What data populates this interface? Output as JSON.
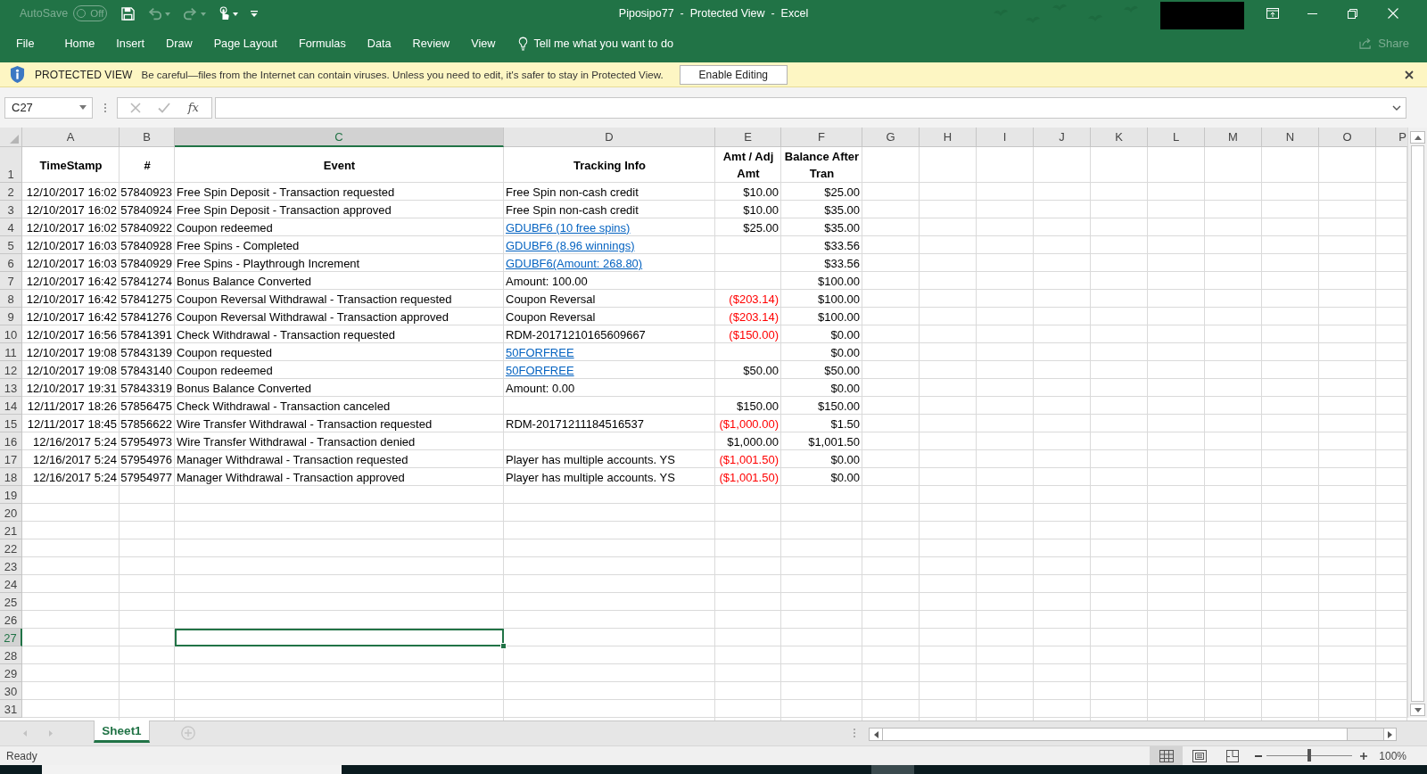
{
  "window": {
    "title": "Piposipo77  -  Protected View  -  Excel"
  },
  "quick_access": {
    "autosave": {
      "label": "AutoSave",
      "toggle_label": "Off",
      "on": false,
      "disabled": true
    },
    "buttons": [
      {
        "kind": "save",
        "disabled": false
      },
      {
        "kind": "undo",
        "disabled": true
      },
      {
        "kind": "redo",
        "disabled": true
      },
      {
        "kind": "touch",
        "disabled": false
      },
      {
        "kind": "customize",
        "disabled": false
      }
    ]
  },
  "ribbon": {
    "tabs": [
      {
        "label": "File"
      },
      {
        "label": "Home"
      },
      {
        "label": "Insert"
      },
      {
        "label": "Draw"
      },
      {
        "label": "Page Layout"
      },
      {
        "label": "Formulas"
      },
      {
        "label": "Data"
      },
      {
        "label": "Review"
      },
      {
        "label": "View"
      }
    ],
    "tell_me": {
      "placeholder": "Tell me what you want to do"
    },
    "share": {
      "label": "Share",
      "disabled": true
    }
  },
  "protected_view": {
    "title": "PROTECTED VIEW",
    "message": "Be careful—files from the Internet can contain viruses. Unless you need to edit, it's safer to stay in Protected View.",
    "button": "Enable Editing"
  },
  "formula_bar": {
    "name_box": "C27",
    "insert_function": "fx"
  },
  "sheet": {
    "columns": [
      {
        "label": "A",
        "selected": false
      },
      {
        "label": "B",
        "selected": false
      },
      {
        "label": "C",
        "selected": true
      },
      {
        "label": "D",
        "selected": false
      },
      {
        "label": "E",
        "selected": false
      },
      {
        "label": "F",
        "selected": false
      },
      {
        "label": "G",
        "selected": false
      },
      {
        "label": "H",
        "selected": false
      },
      {
        "label": "I",
        "selected": false
      },
      {
        "label": "J",
        "selected": false
      },
      {
        "label": "K",
        "selected": false
      },
      {
        "label": "L",
        "selected": false
      },
      {
        "label": "M",
        "selected": false
      },
      {
        "label": "N",
        "selected": false
      },
      {
        "label": "O",
        "selected": false
      },
      {
        "label": "P",
        "selected": false
      }
    ],
    "rows": [
      {
        "row_number": "1",
        "selected": false,
        "kind": "header",
        "labels": [
          "TimeStamp",
          "#",
          "Event",
          "Tracking Info",
          "Amt / Adj Amt",
          "Balance After Tran"
        ]
      },
      {
        "row_number": "2",
        "selected": false,
        "kind": "data",
        "timestamp": "12/10/2017 16:02",
        "transaction_no": "57840923",
        "event": "Free Spin Deposit - Transaction requested",
        "tracking_info": {
          "text": "Free Spin non-cash credit",
          "link": false
        },
        "amount": {
          "text": "$10.00",
          "negative": false
        },
        "balance": "$25.00"
      },
      {
        "row_number": "3",
        "selected": false,
        "kind": "data",
        "timestamp": "12/10/2017 16:02",
        "transaction_no": "57840924",
        "event": "Free Spin Deposit - Transaction approved",
        "tracking_info": {
          "text": "Free Spin non-cash credit",
          "link": false
        },
        "amount": {
          "text": "$10.00",
          "negative": false
        },
        "balance": "$35.00"
      },
      {
        "row_number": "4",
        "selected": false,
        "kind": "data",
        "timestamp": "12/10/2017 16:02",
        "transaction_no": "57840922",
        "event": "Coupon redeemed",
        "tracking_info": {
          "text": "GDUBF6 (10 free spins)",
          "link": true
        },
        "amount": {
          "text": "$25.00",
          "negative": false
        },
        "balance": "$35.00"
      },
      {
        "row_number": "5",
        "selected": false,
        "kind": "data",
        "timestamp": "12/10/2017 16:03",
        "transaction_no": "57840928",
        "event": "Free Spins - Completed",
        "tracking_info": {
          "text": "GDUBF6 (8.96 winnings)",
          "link": true
        },
        "balance": "$33.56"
      },
      {
        "row_number": "6",
        "selected": false,
        "kind": "data",
        "timestamp": "12/10/2017 16:03",
        "transaction_no": "57840929",
        "event": "Free Spins - Playthrough Increment",
        "tracking_info": {
          "text": "GDUBF6(Amount: 268.80)",
          "link": true
        },
        "balance": "$33.56"
      },
      {
        "row_number": "7",
        "selected": false,
        "kind": "data",
        "timestamp": "12/10/2017 16:42",
        "transaction_no": "57841274",
        "event": "Bonus Balance Converted",
        "tracking_info": {
          "text": "Amount: 100.00",
          "link": false
        },
        "balance": "$100.00"
      },
      {
        "row_number": "8",
        "selected": false,
        "kind": "data",
        "timestamp": "12/10/2017 16:42",
        "transaction_no": "57841275",
        "event": "Coupon Reversal Withdrawal - Transaction requested",
        "tracking_info": {
          "text": "Coupon Reversal",
          "link": false
        },
        "amount": {
          "text": "($203.14)",
          "negative": true
        },
        "balance": "$100.00"
      },
      {
        "row_number": "9",
        "selected": false,
        "kind": "data",
        "timestamp": "12/10/2017 16:42",
        "transaction_no": "57841276",
        "event": "Coupon Reversal Withdrawal - Transaction approved",
        "tracking_info": {
          "text": "Coupon Reversal",
          "link": false
        },
        "amount": {
          "text": "($203.14)",
          "negative": true
        },
        "balance": "$100.00"
      },
      {
        "row_number": "10",
        "selected": false,
        "kind": "data",
        "timestamp": "12/10/2017 16:56",
        "transaction_no": "57841391",
        "event": "Check Withdrawal - Transaction requested",
        "tracking_info": {
          "text": "RDM-20171210165609667",
          "link": false
        },
        "amount": {
          "text": "($150.00)",
          "negative": true
        },
        "balance": "$0.00"
      },
      {
        "row_number": "11",
        "selected": false,
        "kind": "data",
        "timestamp": "12/10/2017 19:08",
        "transaction_no": "57843139",
        "event": "Coupon requested",
        "tracking_info": {
          "text": "50FORFREE",
          "link": true
        },
        "balance": "$0.00"
      },
      {
        "row_number": "12",
        "selected": false,
        "kind": "data",
        "timestamp": "12/10/2017 19:08",
        "transaction_no": "57843140",
        "event": "Coupon redeemed",
        "tracking_info": {
          "text": "50FORFREE",
          "link": true
        },
        "amount": {
          "text": "$50.00",
          "negative": false
        },
        "balance": "$50.00"
      },
      {
        "row_number": "13",
        "selected": false,
        "kind": "data",
        "timestamp": "12/10/2017 19:31",
        "transaction_no": "57843319",
        "event": "Bonus Balance Converted",
        "tracking_info": {
          "text": "Amount: 0.00",
          "link": false
        },
        "balance": "$0.00"
      },
      {
        "row_number": "14",
        "selected": false,
        "kind": "data",
        "timestamp": "12/11/2017 18:26",
        "transaction_no": "57856475",
        "event": "Check Withdrawal - Transaction canceled",
        "amount": {
          "text": "$150.00",
          "negative": false
        },
        "balance": "$150.00"
      },
      {
        "row_number": "15",
        "selected": false,
        "kind": "data",
        "timestamp": "12/11/2017 18:45",
        "transaction_no": "57856622",
        "event": "Wire Transfer Withdrawal - Transaction requested",
        "tracking_info": {
          "text": "RDM-20171211184516537",
          "link": false
        },
        "amount": {
          "text": "($1,000.00)",
          "negative": true
        },
        "balance": "$1.50"
      },
      {
        "row_number": "16",
        "selected": false,
        "kind": "data",
        "timestamp": "12/16/2017 5:24",
        "transaction_no": "57954973",
        "event": "Wire Transfer Withdrawal - Transaction denied",
        "amount": {
          "text": "$1,000.00",
          "negative": false
        },
        "balance": "$1,001.50"
      },
      {
        "row_number": "17",
        "selected": false,
        "kind": "data",
        "timestamp": "12/16/2017 5:24",
        "transaction_no": "57954976",
        "event": "Manager Withdrawal - Transaction requested",
        "tracking_info": {
          "text": "Player has multiple accounts. YS",
          "link": false
        },
        "amount": {
          "text": "($1,001.50)",
          "negative": true
        },
        "balance": "$0.00"
      },
      {
        "row_number": "18",
        "selected": false,
        "kind": "data",
        "timestamp": "12/16/2017 5:24",
        "transaction_no": "57954977",
        "event": "Manager Withdrawal - Transaction approved",
        "tracking_info": {
          "text": "Player has multiple accounts. YS",
          "link": false
        },
        "amount": {
          "text": "($1,001.50)",
          "negative": true
        },
        "balance": "$0.00"
      },
      {
        "row_number": "19",
        "selected": false,
        "kind": "data"
      },
      {
        "row_number": "20",
        "selected": false,
        "kind": "data"
      },
      {
        "row_number": "21",
        "selected": false,
        "kind": "data"
      },
      {
        "row_number": "22",
        "selected": false,
        "kind": "data"
      },
      {
        "row_number": "23",
        "selected": false,
        "kind": "data"
      },
      {
        "row_number": "24",
        "selected": false,
        "kind": "data"
      },
      {
        "row_number": "25",
        "selected": false,
        "kind": "data"
      },
      {
        "row_number": "26",
        "selected": false,
        "kind": "data"
      },
      {
        "row_number": "27",
        "selected": true,
        "kind": "data"
      },
      {
        "row_number": "28",
        "selected": false,
        "kind": "data"
      },
      {
        "row_number": "29",
        "selected": false,
        "kind": "data"
      },
      {
        "row_number": "30",
        "selected": false,
        "kind": "data"
      },
      {
        "row_number": "31",
        "selected": false,
        "kind": "data"
      }
    ]
  },
  "sheet_tabs": [
    {
      "label": "Sheet1",
      "selected": true
    }
  ],
  "status_bar": {
    "status": "Ready",
    "views": [
      {
        "kind": "normal",
        "selected": true
      },
      {
        "kind": "page_layout",
        "selected": false
      },
      {
        "kind": "page_break",
        "selected": false
      }
    ],
    "zoom": {
      "level": 0.5,
      "label": "100%"
    }
  }
}
